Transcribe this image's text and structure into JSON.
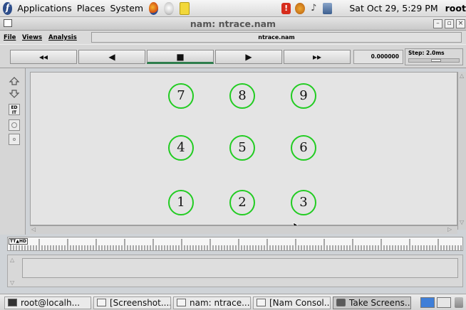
{
  "panel": {
    "menus": [
      "Applications",
      "Places",
      "System"
    ],
    "clock": "Sat Oct 29,  5:29 PM",
    "user": "root"
  },
  "window": {
    "title": "nam: ntrace.nam"
  },
  "nam": {
    "menus": [
      "File",
      "Views",
      "Analysis"
    ],
    "filename": "ntrace.nam",
    "controls": {
      "rewind": "◂◂",
      "back": "◀",
      "stop": "■",
      "play": "▶",
      "ffwd": "▸▸"
    },
    "time": "0.000000",
    "step": "Step: 2.0ms",
    "edit_label": "ED\nIT",
    "timeline_label": "TT▲HD"
  },
  "nodes": [
    {
      "label": "7"
    },
    {
      "label": "8"
    },
    {
      "label": "9"
    },
    {
      "label": "4"
    },
    {
      "label": "5"
    },
    {
      "label": "6"
    },
    {
      "label": "1"
    },
    {
      "label": "2"
    },
    {
      "label": "3"
    }
  ],
  "taskbar": [
    {
      "label": "root@localh...",
      "icon": "terminal-icon"
    },
    {
      "label": "[Screenshot....",
      "icon": "window-icon"
    },
    {
      "label": "nam: ntrace....",
      "icon": "window-icon"
    },
    {
      "label": "[Nam Consol...",
      "icon": "window-icon"
    },
    {
      "label": "Take Screens...",
      "icon": "camera-icon"
    }
  ],
  "colors": {
    "node_outline": "#22cc22",
    "stop_indicator": "#2e7d4d",
    "workspace_active": "#3f7fd8"
  }
}
